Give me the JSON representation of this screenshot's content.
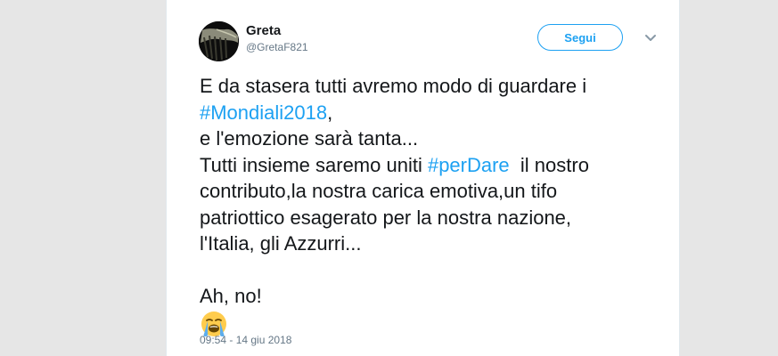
{
  "tweet": {
    "author": {
      "display_name": "Greta",
      "handle": "@GretaF821"
    },
    "follow_label": "Segui",
    "text": {
      "line1": "E da stasera tutti avremo modo di guardare i",
      "hashtag1": "#Mondiali2018",
      "line2_suffix": ",",
      "line3": "e l'emozione sarà tanta...",
      "line4_prefix": "Tutti insieme saremo uniti ",
      "hashtag2": "#perDare",
      "line4_suffix": "  il nostro",
      "line5": "contributo,la nostra carica emotiva,un tifo",
      "line6": "patriottico esagerato per la nostra nazione,",
      "line7": "l'Italia, gli Azzurri...",
      "line8": "Ah, no!"
    },
    "emoji": "loudly-crying-face-icon",
    "timestamp": "09:54 - 14 giu 2018"
  },
  "colors": {
    "accent": "#1da1f2",
    "text": "#14171a",
    "muted": "#657786",
    "page_background": "#e6e6e6"
  }
}
